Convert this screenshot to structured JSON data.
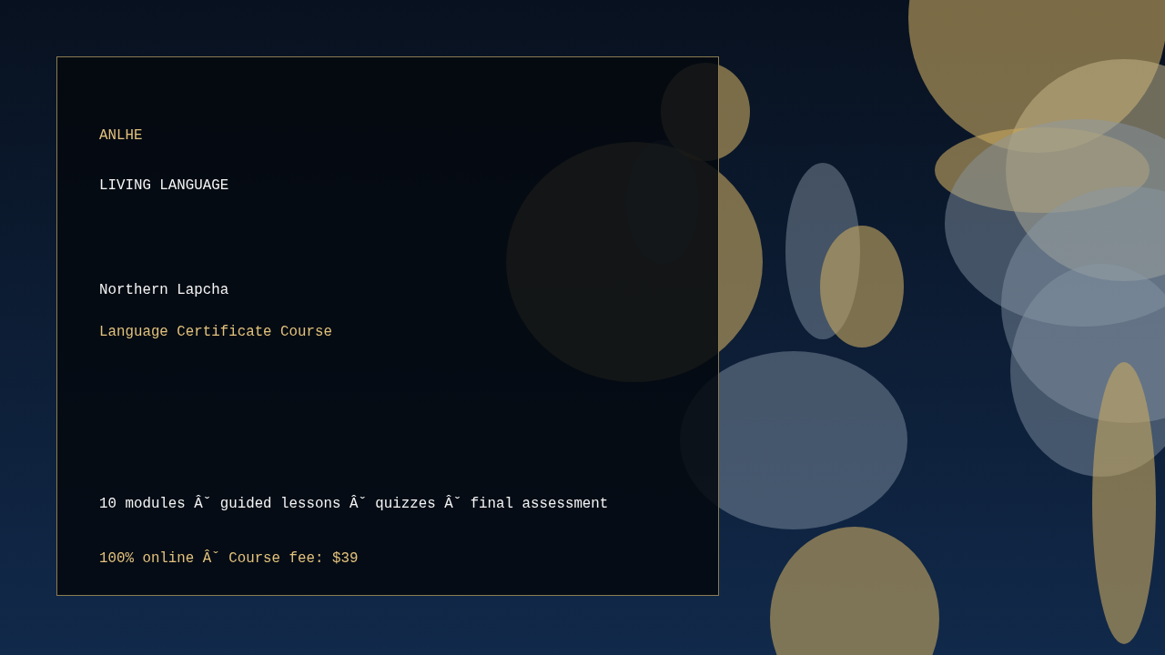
{
  "card": {
    "eyebrow": "ANLHE",
    "series": "LIVING LANGUAGE",
    "language": "Northern Lapcha",
    "course": "Language Certificate Course",
    "features": "10 modules Âˇ guided lessons Âˇ quizzes Âˇ final assessment",
    "pricing": "100% online Âˇ Course fee: $39"
  }
}
